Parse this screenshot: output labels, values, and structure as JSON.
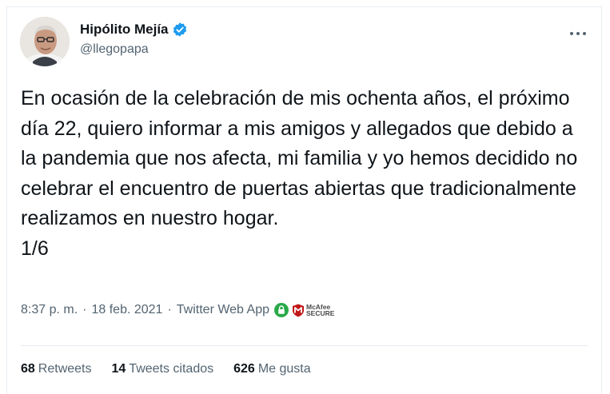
{
  "author": {
    "name": "Hipólito Mejía",
    "handle": "@llegopapa",
    "verified": true
  },
  "more_icon": "more-horizontal-icon",
  "tweet": {
    "lines": [
      "En ocasión de la celebración de mis ochenta años, el próximo día 22, quiero informar a mis amigos y allegados que debido a la pandemia que nos afecta, mi familia y yo hemos decidido no celebrar el encuentro de puertas abiertas que tradicionalmente realizamos en nuestro hogar.",
      "1/6"
    ]
  },
  "meta": {
    "time": "8:37 p. m.",
    "separator": "·",
    "date": "18 feb. 2021",
    "source": "Twitter Web App",
    "mcafee_line1": "McAfee",
    "mcafee_line2": "SECURE"
  },
  "stats": {
    "retweets_count": "68",
    "retweets_label": "Retweets",
    "quotes_count": "14",
    "quotes_label": "Tweets citados",
    "likes_count": "626",
    "likes_label": "Me gusta"
  },
  "colors": {
    "text": "#0f1419",
    "secondary": "#536471",
    "verified": "#1d9bf0",
    "divider": "#e6ecf0",
    "lock_green": "#2aa94a",
    "mcafee_red": "#c01818"
  }
}
